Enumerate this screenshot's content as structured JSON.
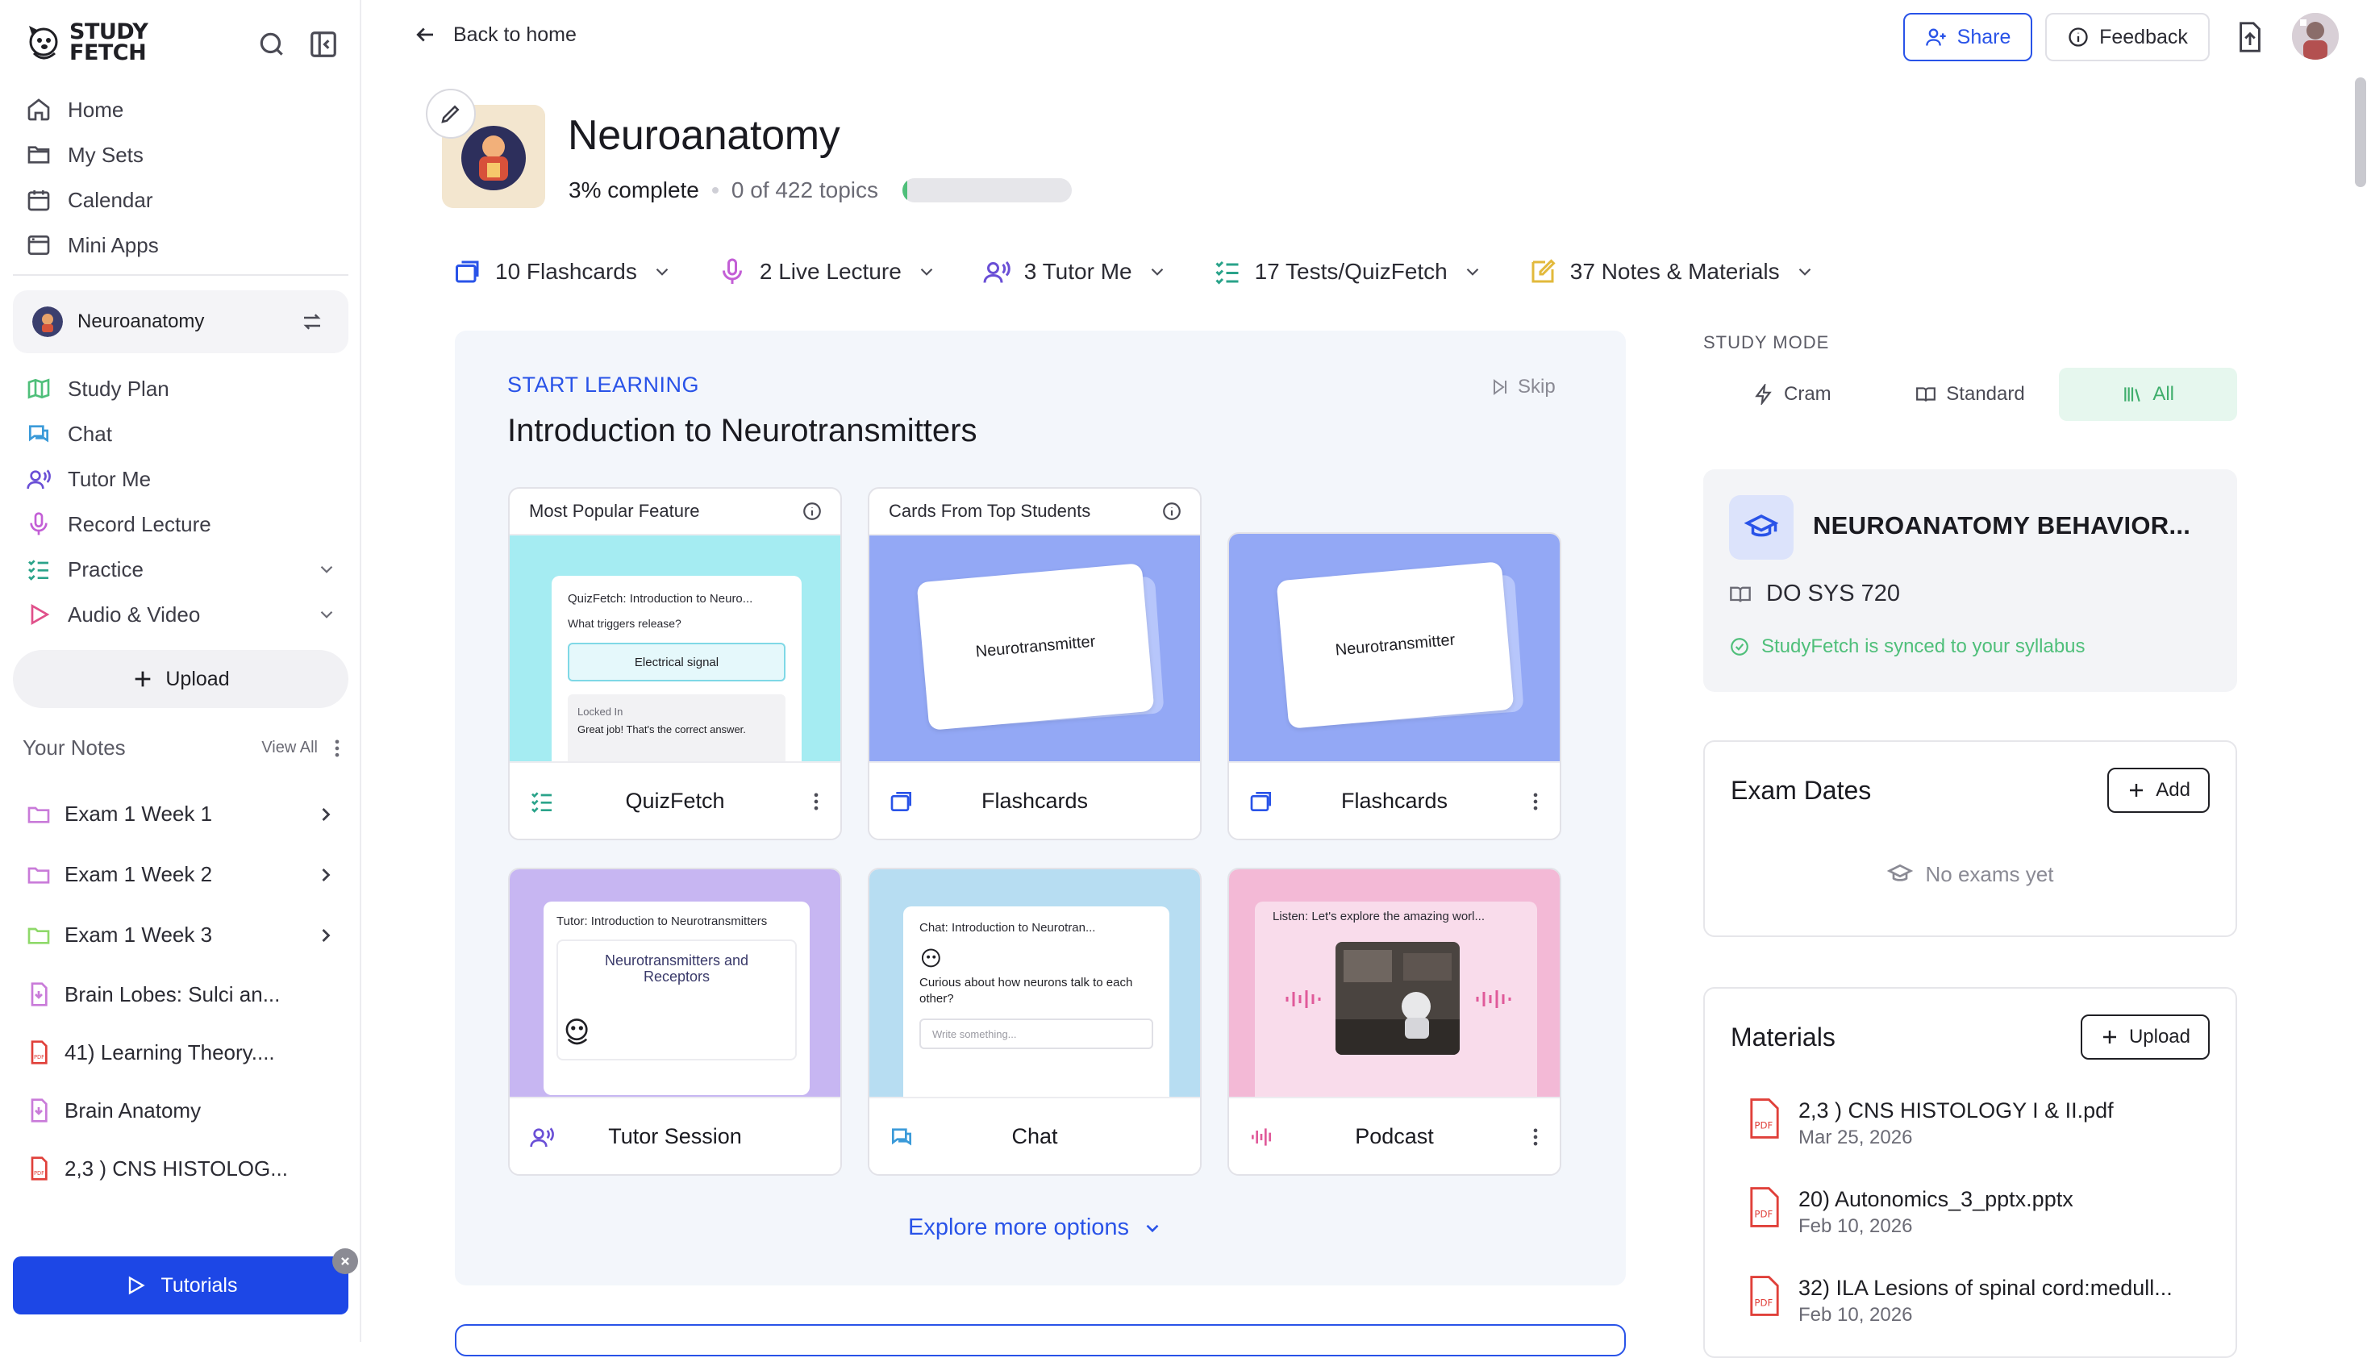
{
  "app": {
    "logo_line1": "STUDY",
    "logo_line2": "FETCH"
  },
  "sidebar": {
    "nav": [
      {
        "label": "Home",
        "icon": "home-icon"
      },
      {
        "label": "My Sets",
        "icon": "folder-icon"
      },
      {
        "label": "Calendar",
        "icon": "calendar-icon"
      },
      {
        "label": "Mini Apps",
        "icon": "apps-icon"
      }
    ],
    "current_set": "Neuroanatomy",
    "set_nav": [
      {
        "label": "Study Plan",
        "icon": "map-icon"
      },
      {
        "label": "Chat",
        "icon": "chat-icon"
      },
      {
        "label": "Tutor Me",
        "icon": "tutor-icon"
      },
      {
        "label": "Record Lecture",
        "icon": "mic-icon"
      },
      {
        "label": "Practice",
        "icon": "practice-icon"
      },
      {
        "label": "Audio & Video",
        "icon": "play-icon"
      }
    ],
    "upload_label": "Upload",
    "your_notes_label": "Your Notes",
    "view_all_label": "View All",
    "notes": [
      {
        "label": "Exam 1 Week 1",
        "type": "folder"
      },
      {
        "label": "Exam 1 Week 2",
        "type": "folder"
      },
      {
        "label": "Exam 1 Week 3",
        "type": "folder"
      },
      {
        "label": "Brain Lobes: Sulci an...",
        "type": "doc"
      },
      {
        "label": "41) Learning Theory....",
        "type": "pdf"
      },
      {
        "label": "Brain Anatomy",
        "type": "doc"
      },
      {
        "label": "2,3 ) CNS HISTOLOG...",
        "type": "pdf"
      }
    ],
    "tutorials_label": "Tutorials"
  },
  "topbar": {
    "back_label": "Back to home",
    "share_label": "Share",
    "feedback_label": "Feedback"
  },
  "header": {
    "title": "Neuroanatomy",
    "percent_complete": "3% complete",
    "topics": "0 of 422 topics",
    "progress_fraction": 0.03
  },
  "categories": [
    {
      "label": "10 Flashcards",
      "icon": "flashcards-icon",
      "color": "#2953e8"
    },
    {
      "label": "2 Live Lecture",
      "icon": "mic-icon",
      "color": "#c35fd6"
    },
    {
      "label": "3 Tutor Me",
      "icon": "tutor-icon",
      "color": "#6a4fd6"
    },
    {
      "label": "17 Tests/QuizFetch",
      "icon": "quiz-icon",
      "color": "#2aa38a"
    },
    {
      "label": "37 Notes & Materials",
      "icon": "notes-icon",
      "color": "#e2b93b"
    }
  ],
  "learning": {
    "label": "START LEARNING",
    "title": "Introduction to Neurotransmitters",
    "skip_label": "Skip",
    "cards": [
      {
        "header": "Most Popular Feature",
        "footer": "QuizFetch",
        "preview_title": "QuizFetch: Introduction to Neuro...",
        "preview_question": "What triggers release?",
        "preview_answer": "Electrical signal",
        "preview_locked": "Locked In",
        "preview_feedback": "Great job! That's the correct answer."
      },
      {
        "header": "Cards From Top Students",
        "footer": "Flashcards",
        "preview_card": "Neurotransmitter"
      },
      {
        "footer": "Flashcards",
        "preview_card": "Neurotransmitter"
      },
      {
        "footer": "Tutor Session",
        "preview_title": "Tutor: Introduction to Neurotransmitters",
        "preview_body": "Neurotransmitters and Receptors"
      },
      {
        "footer": "Chat",
        "preview_title": "Chat: Introduction to Neurotran...",
        "preview_body": "Curious about how neurons talk to each other?",
        "preview_placeholder": "Write something..."
      },
      {
        "footer": "Podcast",
        "preview_title": "Listen: Let's explore the amazing worl..."
      }
    ],
    "explore_label": "Explore more options"
  },
  "right": {
    "study_mode_label": "STUDY MODE",
    "modes": [
      {
        "label": "Cram",
        "active": false
      },
      {
        "label": "Standard",
        "active": false
      },
      {
        "label": "All",
        "active": true
      }
    ],
    "course_name": "NEUROANATOMY BEHAVIOR...",
    "course_code": "DO SYS 720",
    "sync_text": "StudyFetch is synced to your syllabus",
    "exam_dates_label": "Exam Dates",
    "add_label": "Add",
    "no_exams_label": "No exams yet",
    "materials_label": "Materials",
    "materials_upload_label": "Upload",
    "materials": [
      {
        "name": "2,3 ) CNS HISTOLOGY I & II.pdf",
        "date": "Mar 25, 2026"
      },
      {
        "name": "20) Autonomics_3_pptx.pptx",
        "date": "Feb 10, 2026"
      },
      {
        "name": "32) ILA Lesions of spinal cord:medull...",
        "date": "Feb 10, 2026"
      }
    ]
  },
  "colors": {
    "accent": "#2953e8",
    "tutorials_bg": "#1d47e6",
    "progress": "#4fbf7a",
    "mode_active": "#3fae6c"
  }
}
